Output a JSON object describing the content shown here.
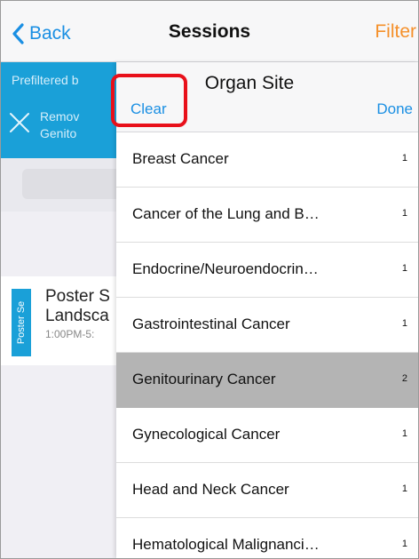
{
  "navbar": {
    "back_label": "Back",
    "title": "Sessions",
    "filter_label": "Filter"
  },
  "background": {
    "prefilter_text": "Prefiltered b",
    "remove_line1": "Remov",
    "remove_line2": "Genito",
    "session": {
      "tag": "Poster Se",
      "title_line1": "Poster S",
      "title_line2": "Landsca",
      "time": "1:00PM-5:"
    }
  },
  "panel": {
    "title": "Organ Site",
    "clear_label": "Clear",
    "done_label": "Done",
    "items": [
      {
        "label": "Breast Cancer",
        "count": "1"
      },
      {
        "label": "Cancer of the Lung and B…",
        "count": "1"
      },
      {
        "label": "Endocrine/Neuroendocrin…",
        "count": "1"
      },
      {
        "label": "Gastrointestinal Cancer",
        "count": "1"
      },
      {
        "label": "Genitourinary Cancer",
        "count": "2"
      },
      {
        "label": "Gynecological Cancer",
        "count": "1"
      },
      {
        "label": "Head and Neck Cancer",
        "count": "1"
      },
      {
        "label": "Hematological Malignanci…",
        "count": "1"
      }
    ],
    "selected_index": 4
  },
  "colors": {
    "accent_blue": "#1a8fe3",
    "filter_orange": "#f5902a",
    "banner_blue": "#1aa0d8",
    "highlight_red": "#e8101a",
    "selected_row": "#b4b4b4"
  }
}
